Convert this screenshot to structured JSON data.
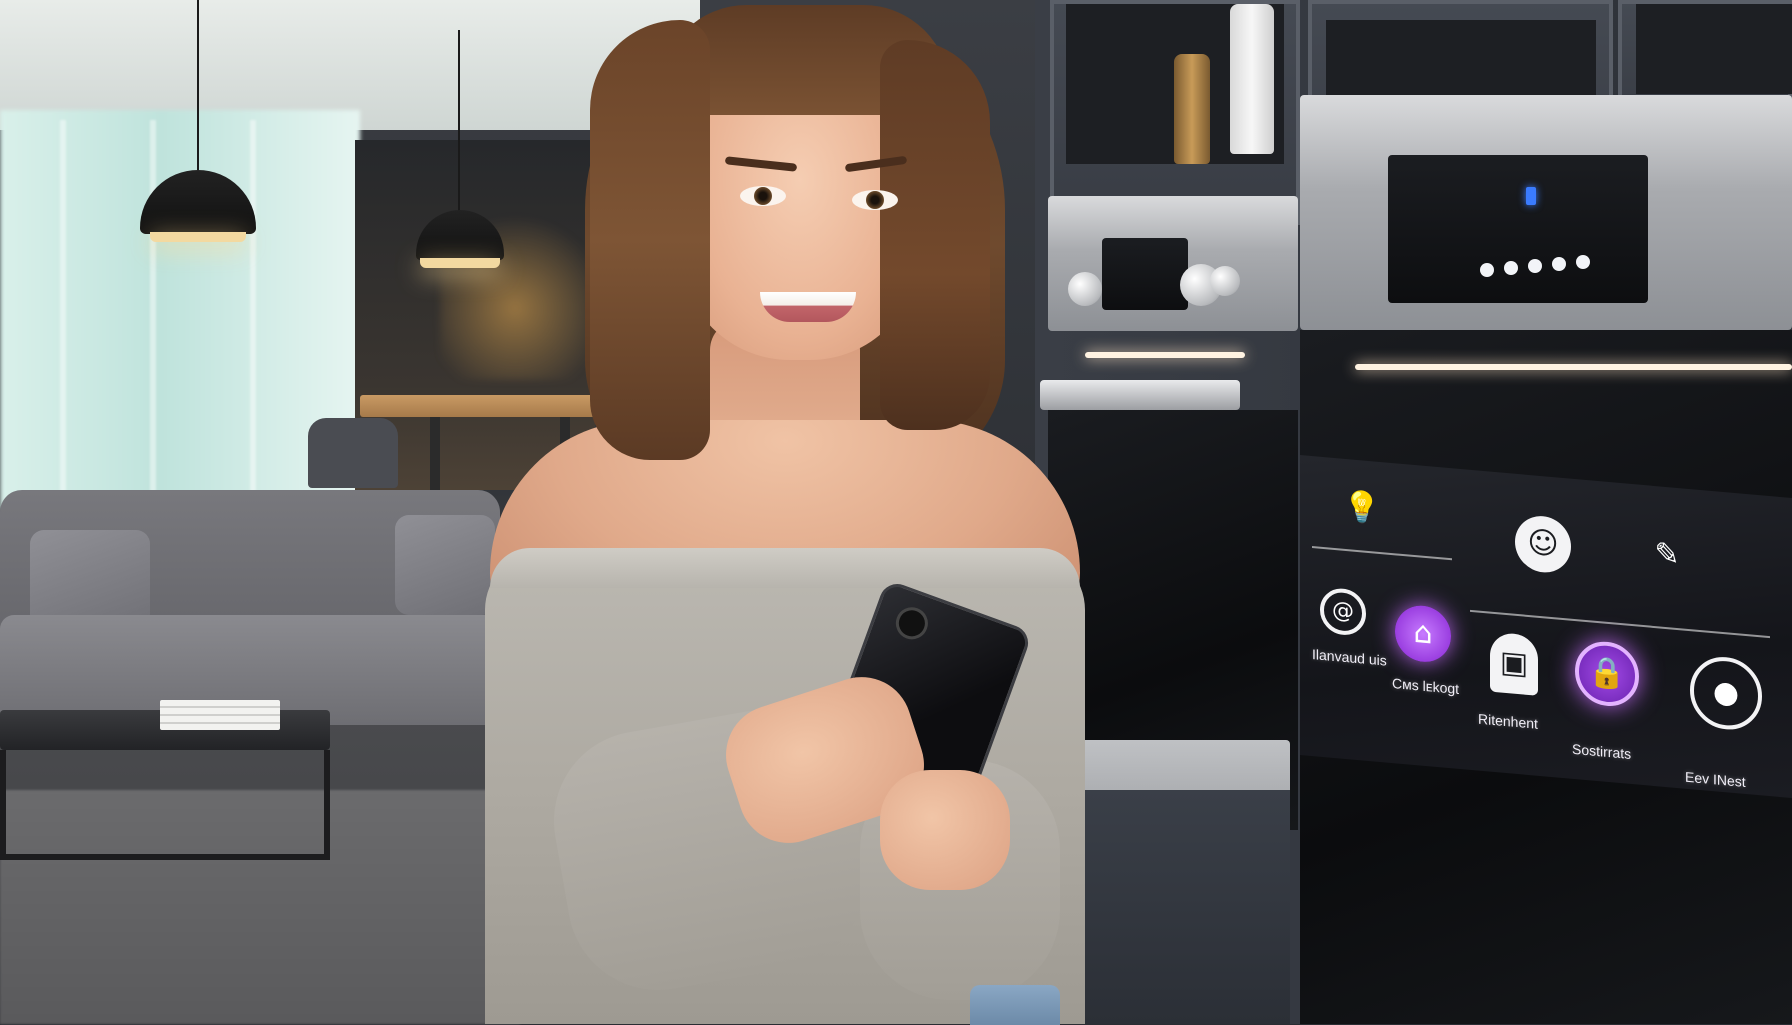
{
  "scene": {
    "description_free": true
  },
  "smart_panel": {
    "icons": [
      {
        "icon": "lightbulb-icon",
        "style": "plain"
      },
      {
        "icon": "face-icon",
        "style": "white"
      },
      {
        "icon": "wand-icon",
        "style": "plain"
      },
      {
        "icon": "swirl-icon",
        "style": "outline"
      },
      {
        "icon": "home-icon",
        "style": "purple"
      },
      {
        "icon": "house-icon",
        "style": "white"
      },
      {
        "icon": "lock-icon",
        "style": "purple-ring"
      },
      {
        "icon": "target-icon",
        "style": "outline"
      }
    ],
    "labels": {
      "label_1": "Ilanvaud uis",
      "label_2": "Cᴍs lᴇkogt",
      "label_3": "Ritenhent",
      "label_4": "Sostirrats",
      "label_5": "Eev INest"
    },
    "accent_color": "#b45cf0"
  },
  "oven": {
    "led_dots": 5,
    "status_indicator_color": "#3a7bff"
  }
}
